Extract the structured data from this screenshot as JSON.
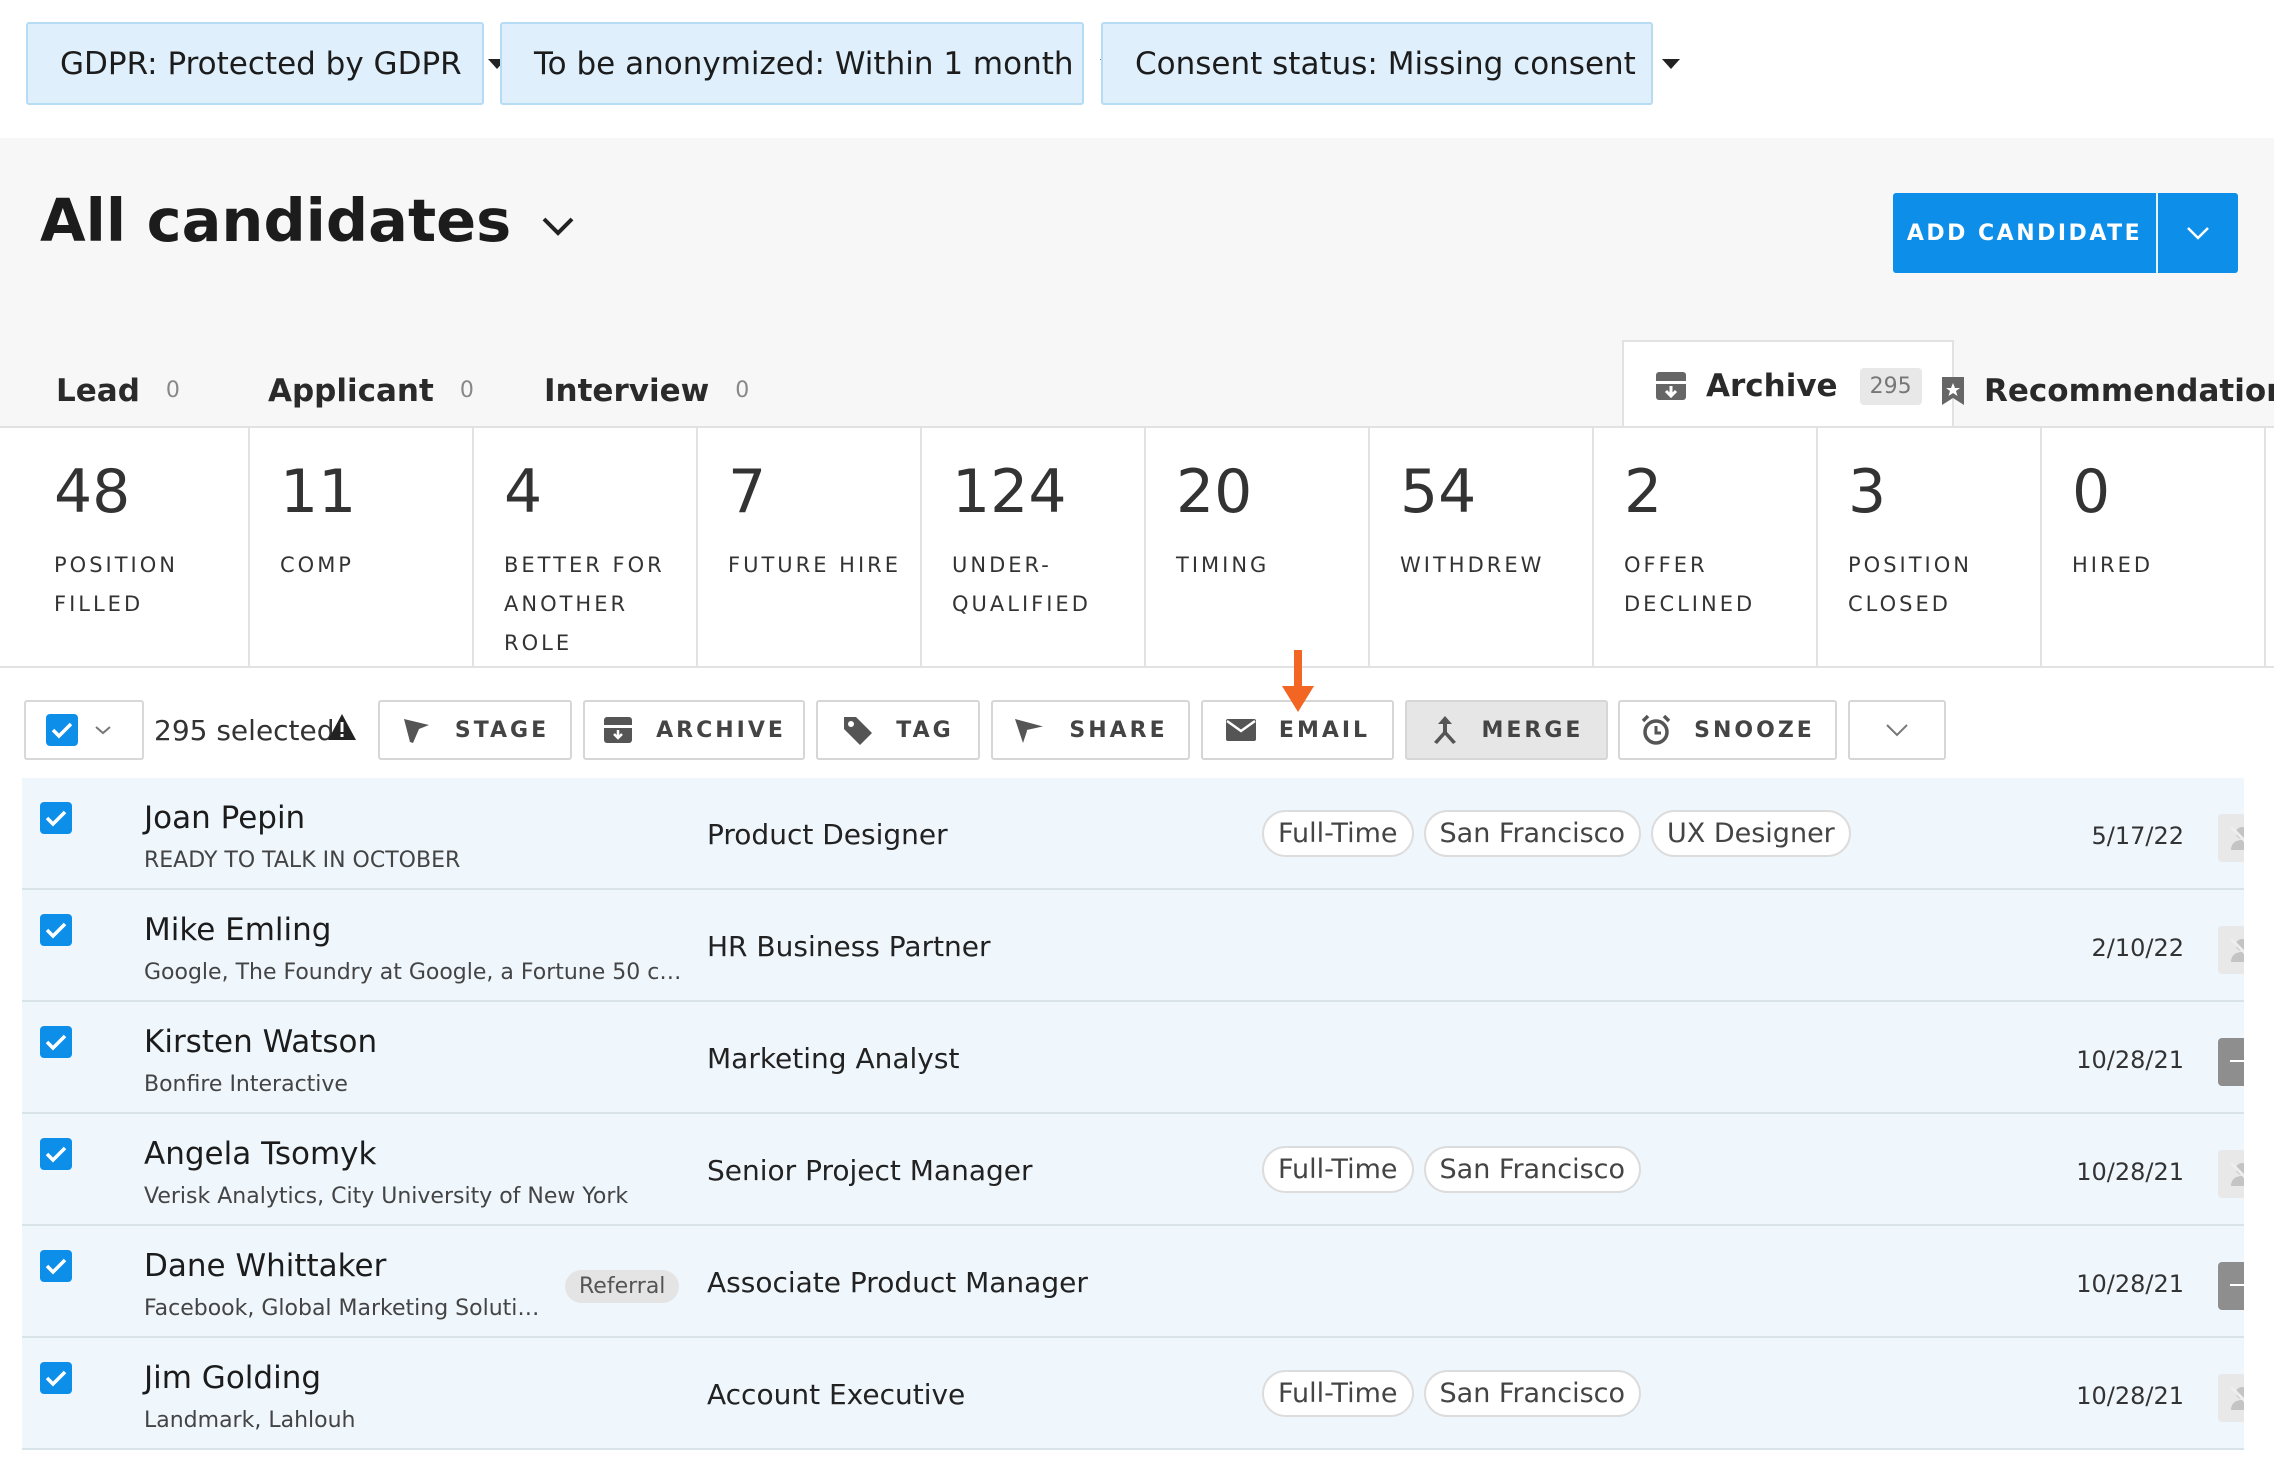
{
  "filters": [
    {
      "label": "GDPR: Protected by GDPR"
    },
    {
      "label": "To be anonymized: Within 1 month"
    },
    {
      "label": "Consent status: Missing consent"
    }
  ],
  "header": {
    "title": "All candidates",
    "add_button": "ADD CANDIDATE"
  },
  "tabs": [
    {
      "label": "Lead",
      "count": "0"
    },
    {
      "label": "Applicant",
      "count": "0"
    },
    {
      "label": "Interview",
      "count": "0"
    },
    {
      "label": "Archive",
      "count": "295"
    },
    {
      "label": "Recommendations"
    }
  ],
  "reasons": [
    {
      "count": "48",
      "label": "Position filled"
    },
    {
      "count": "11",
      "label": "Comp"
    },
    {
      "count": "4",
      "label": "Better for another role"
    },
    {
      "count": "7",
      "label": "Future hire"
    },
    {
      "count": "124",
      "label": "Under-qualified"
    },
    {
      "count": "20",
      "label": "Timing"
    },
    {
      "count": "54",
      "label": "Withdrew"
    },
    {
      "count": "2",
      "label": "Offer declined"
    },
    {
      "count": "3",
      "label": "Position closed"
    },
    {
      "count": "0",
      "label": "Hired"
    }
  ],
  "toolbar": {
    "selected_text": "295 selected",
    "stage": "STAGE",
    "archive": "ARCHIVE",
    "tag": "TAG",
    "share": "SHARE",
    "email": "EMAIL",
    "merge": "MERGE",
    "snooze": "SNOOZE"
  },
  "colors": {
    "accent": "#0d8ee8",
    "arrow": "#f26522",
    "filter_bg": "#dff0fc"
  },
  "rows": [
    {
      "name": "Joan Pepin",
      "sub": "READY TO TALK IN OCTOBER",
      "position": "Product Designer",
      "tags": [
        "Full-Time",
        "San Francisco",
        "UX Designer"
      ],
      "date": "5/17/22"
    },
    {
      "name": "Mike Emling",
      "sub": "Google, The Foundry at Google, a Fortune 50 comp...",
      "position": "HR Business Partner",
      "tags": [],
      "date": "2/10/22"
    },
    {
      "name": "Kirsten Watson",
      "sub": "Bonfire Interactive",
      "position": "Marketing Analyst",
      "tags": [],
      "date": "10/28/21"
    },
    {
      "name": "Angela Tsomyk",
      "sub": "Verisk Analytics, City University of New York",
      "position": "Senior Project Manager",
      "tags": [
        "Full-Time",
        "San Francisco"
      ],
      "date": "10/28/21"
    },
    {
      "name": "Dane Whittaker",
      "sub": "Facebook, Global Marketing Solutio...",
      "badge": "Referral",
      "position": "Associate Product Manager",
      "tags": [],
      "date": "10/28/21"
    },
    {
      "name": "Jim Golding",
      "sub": "Landmark, Lahlouh",
      "position": "Account Executive",
      "tags": [
        "Full-Time",
        "San Francisco"
      ],
      "date": "10/28/21"
    }
  ]
}
